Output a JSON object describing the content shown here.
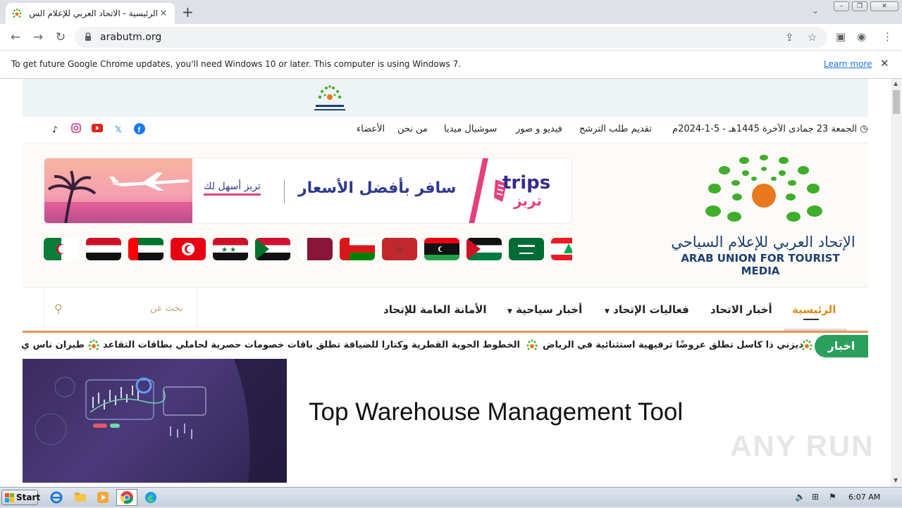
{
  "browser": {
    "tab_title": "الرئيسية - الاتحاد العربي للإعلام الس...",
    "url": "arabutm.org",
    "update_message": "To get future Google Chrome updates, you'll need Windows 10 or later. This computer is using Windows 7.",
    "learn_more": "Learn more"
  },
  "site": {
    "date_text": "الجمعة 23 جمادى الآخرة 1445هـ - 5-1-2024م",
    "top_nav": [
      "تقديم طلب الترشح",
      "فيديو و صور",
      "سوشيال ميديا",
      "من نحن",
      "الأعضاء"
    ],
    "social": [
      "facebook-icon",
      "x-icon",
      "youtube-icon",
      "instagram-icon",
      "tiktok-icon"
    ],
    "logo_ar": "الإتحاد العربي للإعلام السياحي",
    "logo_en": "ARAB UNION FOR TOURIST MEDIA",
    "banner": {
      "slogan": "سافر بأفضل الأسعار",
      "easy": "تربز أسهل لك",
      "brand": "trips",
      "brand_ar": "تربز"
    },
    "main_nav": {
      "home": "الرئيسية",
      "union_news": "أخبار الاتحاد",
      "union_events": "فعاليات الإتحاد",
      "tourism_news": "أخبار سياحية",
      "secretariat": "الأمانة العامة للإتحاد",
      "search_placeholder": "بحث عن"
    },
    "ticker": {
      "label": "اخبار",
      "items": [
        "ديزني ذا كاسل تطلق عروضًا ترفيهية استثنائية في الرياض",
        "الخطوط الجوية القطرية وكتارا للضيافة تطلق باقات خصومات حصرية لحاملي بطاقات التقاعد",
        "طيران ناس ي"
      ]
    },
    "article": {
      "title": "Top Warehouse Management Tool"
    },
    "watermark": "ANY RUN"
  },
  "taskbar": {
    "start": "Start",
    "clock": "6:07 AM"
  },
  "colors": {
    "accent_orange": "#e08a1e",
    "ticker_green": "#2aa05c",
    "logo_blue": "#1d3f74",
    "logo_green": "#3fae2a",
    "logo_orange": "#e8781e"
  }
}
